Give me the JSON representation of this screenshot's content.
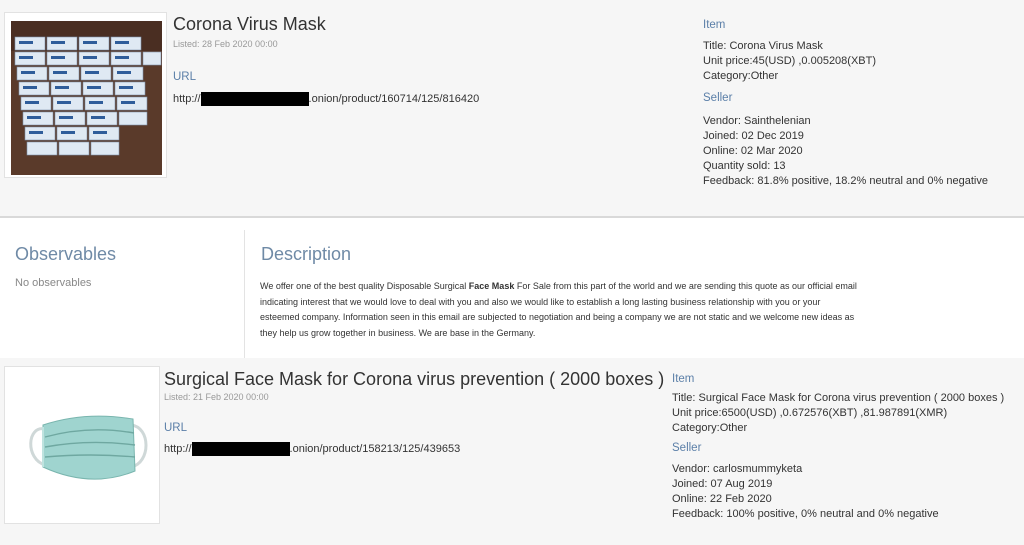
{
  "listing1": {
    "title": "Corona Virus Mask",
    "listed": "Listed: 28 Feb 2020 00:00",
    "url_label": "URL",
    "url_prefix": "http://",
    "url_suffix": ".onion/product/160714/125/816420",
    "item_label": "Item",
    "item_lines": [
      "Title: Corona Virus Mask",
      "Unit price:45(USD) ,0.005208(XBT)",
      "Category:Other"
    ],
    "seller_label": "Seller",
    "seller_lines": [
      "Vendor: Sainthelenian",
      "Joined: 02 Dec 2019",
      "Online: 02 Mar 2020",
      "Quantity sold: 13",
      "Feedback: 81.8% positive, 18.2% neutral and 0% negative"
    ]
  },
  "observables": {
    "title": "Observables",
    "empty_text": "No observables"
  },
  "description": {
    "title": "Description",
    "text_before": "We offer one of the best quality  Disposable Surgical ",
    "text_bold": "Face Mask",
    "text_after": " For Sale from this part of the world and we are sending this quote as our official email indicating interest that we would love to deal with you and also we would like to establish a long lasting business relationship with you or your esteemed company. Information seen in this email are subjected to negotiation and being a company we are not static and we welcome new ideas as they help us grow together in business. We are base in the Germany."
  },
  "listing2": {
    "title": "Surgical Face Mask for Corona virus prevention ( 2000 boxes )",
    "listed": "Listed: 21 Feb 2020 00:00",
    "url_label": "URL",
    "url_prefix": "http://",
    "url_suffix": ".onion/product/158213/125/439653",
    "item_label": "Item",
    "item_lines": [
      "Title: Surgical Face Mask for Corona virus prevention ( 2000 boxes )",
      "Unit price:6500(USD) ,0.672576(XBT) ,81.987891(XMR)",
      "Category:Other"
    ],
    "seller_label": "Seller",
    "seller_lines": [
      "Vendor: carlosmummyketa",
      "Joined: 07 Aug 2019",
      "Online: 22 Feb 2020",
      "Feedback: 100% positive, 0% neutral and 0% negative"
    ]
  }
}
